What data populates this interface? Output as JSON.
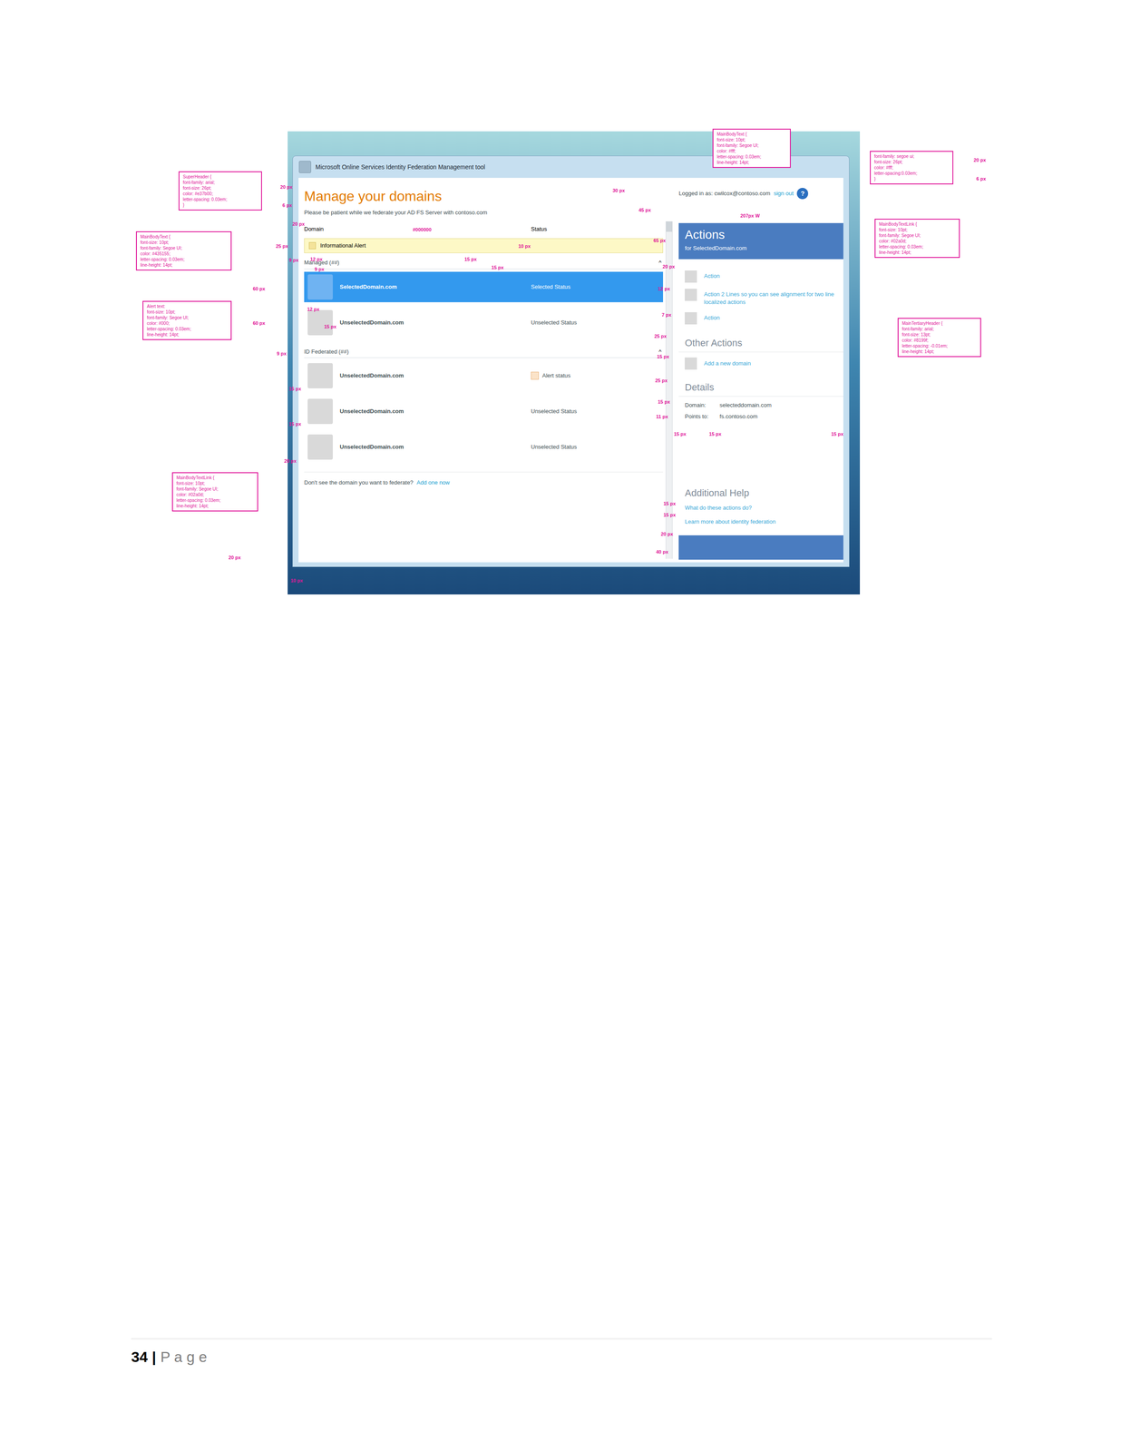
{
  "screenshot": {
    "window": {
      "title": "Microsoft Online Services Identity Federation Management tool"
    },
    "header": {
      "title": "Manage your domains",
      "subtitle": "Please be patient while we federate your AD FS Server with contoso.com"
    },
    "account": {
      "logged_in": "Logged in as: cwilcox@contoso.com",
      "sign_out": "sign out",
      "help": "?"
    },
    "table": {
      "columns": [
        "Domain",
        "Status"
      ]
    },
    "alert": {
      "text": "Informational Alert"
    },
    "groups": [
      {
        "label": "Managed (##)",
        "toggle": "^",
        "rows": [
          {
            "domain": "SelectedDomain.com",
            "status": "Selected Status",
            "selected": true,
            "alert": false
          },
          {
            "domain": "UnselectedDomain.com",
            "status": "Unselected Status",
            "selected": false,
            "alert": false
          }
        ]
      },
      {
        "label": "ID Federated (##)",
        "toggle": "^",
        "rows": [
          {
            "domain": "UnselectedDomain.com",
            "status": "Alert status",
            "selected": false,
            "alert": true
          },
          {
            "domain": "UnselectedDomain.com",
            "status": "Unselected Status",
            "selected": false,
            "alert": false
          },
          {
            "domain": "UnselectedDomain.com",
            "status": "Unselected Status",
            "selected": false,
            "alert": false
          }
        ]
      }
    ],
    "footer": {
      "text": "Don't see the domain you want to federate?",
      "link": "Add one now"
    },
    "actions": {
      "title": "Actions",
      "subtitle": "for SelectedDomain.com",
      "items": [
        "Action",
        "Action 2 Lines so you can see alignment for two line localized actions",
        "Action"
      ]
    },
    "other_actions": {
      "title": "Other Actions",
      "items": [
        "Add a new domain"
      ]
    },
    "details": {
      "title": "Details",
      "fields": [
        {
          "label": "Domain:",
          "value": "selecteddomain.com"
        },
        {
          "label": "Points to:",
          "value": "fs.contoso.com"
        }
      ]
    },
    "help": {
      "title": "Additional Help",
      "links": [
        "What do these actions do?",
        "Learn more about identity federation"
      ]
    }
  },
  "labels": [
    "20 px",
    "6 px",
    "20 px",
    "25 px",
    "9 px",
    "12 px",
    "9 px",
    "60 px",
    "12 px",
    "15 px",
    "60 px",
    "9 px",
    "15 px",
    "15 px",
    "20 px",
    "20 px",
    "10 px",
    "#000000",
    "10 px",
    "15 px",
    "15 px",
    "30 px",
    "45 px",
    "207px W",
    "65 px",
    "20 px",
    "12 px",
    "7 px",
    "25 px",
    "15 px",
    "25 px",
    "15 px",
    "11 px",
    "15 px",
    "15 px",
    "15 px",
    "15 px",
    "15 px",
    "20 px",
    "40 px",
    "20 px",
    "6 px"
  ],
  "callouts": [
    [
      "SuperHeader {",
      "font-family: arial;",
      "font-size: 26pt;",
      "color: #e37b00;",
      "letter-spacing: 0.03em;",
      "}"
    ],
    [
      "MainBodyText {",
      "font-size: 10pt;",
      "font-family: Segoe UI;",
      "color: #435155;",
      "letter-spacing: 0.03em;",
      "line-height: 14pt;"
    ],
    [
      "Alert text:",
      "font-size: 10pt;",
      "font-family: Segoe UI;",
      "color: #000;",
      "letter-spacing: 0.03em;",
      "line-height: 14pt;"
    ],
    [
      "MainBodyTextLink {",
      "font-size: 10pt;",
      "font-family: Segoe UI;",
      "color: #02a0d;",
      "letter-spacing: 0.03em;",
      "line-height: 14pt;"
    ],
    [
      "MainBodyText {",
      "font-size: 10pt;",
      "font-family: Segoe UI;",
      "color: #fff;",
      "letter-spacing: 0.03em;",
      "line-height: 14pt;"
    ],
    [
      "font-family: segoe ui;",
      "font-size: 26pt;",
      "color: #fff;",
      "letter-spacing:0.03em;",
      "}"
    ],
    [
      "MainBodyTextLink {",
      "font-size: 10pt;",
      "font-family: Segoe UI;",
      "color: #02a0d;",
      "letter-spacing: 0.03em;",
      "line-height: 14pt;"
    ],
    [
      "MainTertiaryHeader {",
      "font-family: arial;",
      "font-size: 13pt;",
      "color: #8199f;",
      "letter-spacing: -0.01em;",
      "line-height: 14pt;"
    ]
  ],
  "page_footer": {
    "page": "34",
    "separator": "|",
    "label": "P a g e"
  }
}
